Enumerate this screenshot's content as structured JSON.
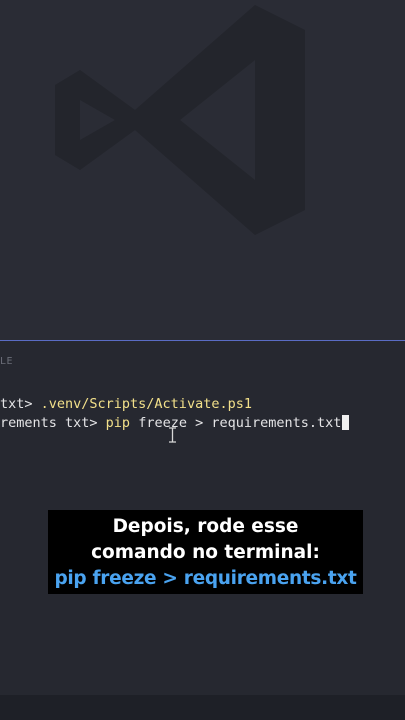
{
  "editor": {
    "watermark_icon": "vscode-logo-icon"
  },
  "terminal": {
    "tab_label": "LE",
    "line1_prefix": "txt> ",
    "line1_command": ".venv/Scripts/Activate.ps1",
    "line2_prefix": "rements txt> ",
    "line2_command": "pip",
    "line2_rest": " freeze > requirements.txt"
  },
  "caption": {
    "line1": "Depois, rode esse",
    "line2": "comando no terminal:",
    "line3": "pip freeze > requirements.txt"
  },
  "colors": {
    "editor_bg": "#2a2c35",
    "terminal_bg": "#262830",
    "panel_border": "#5a6cc4",
    "command_yellow": "#f2e08a",
    "caption_highlight": "#4aa3f0"
  }
}
